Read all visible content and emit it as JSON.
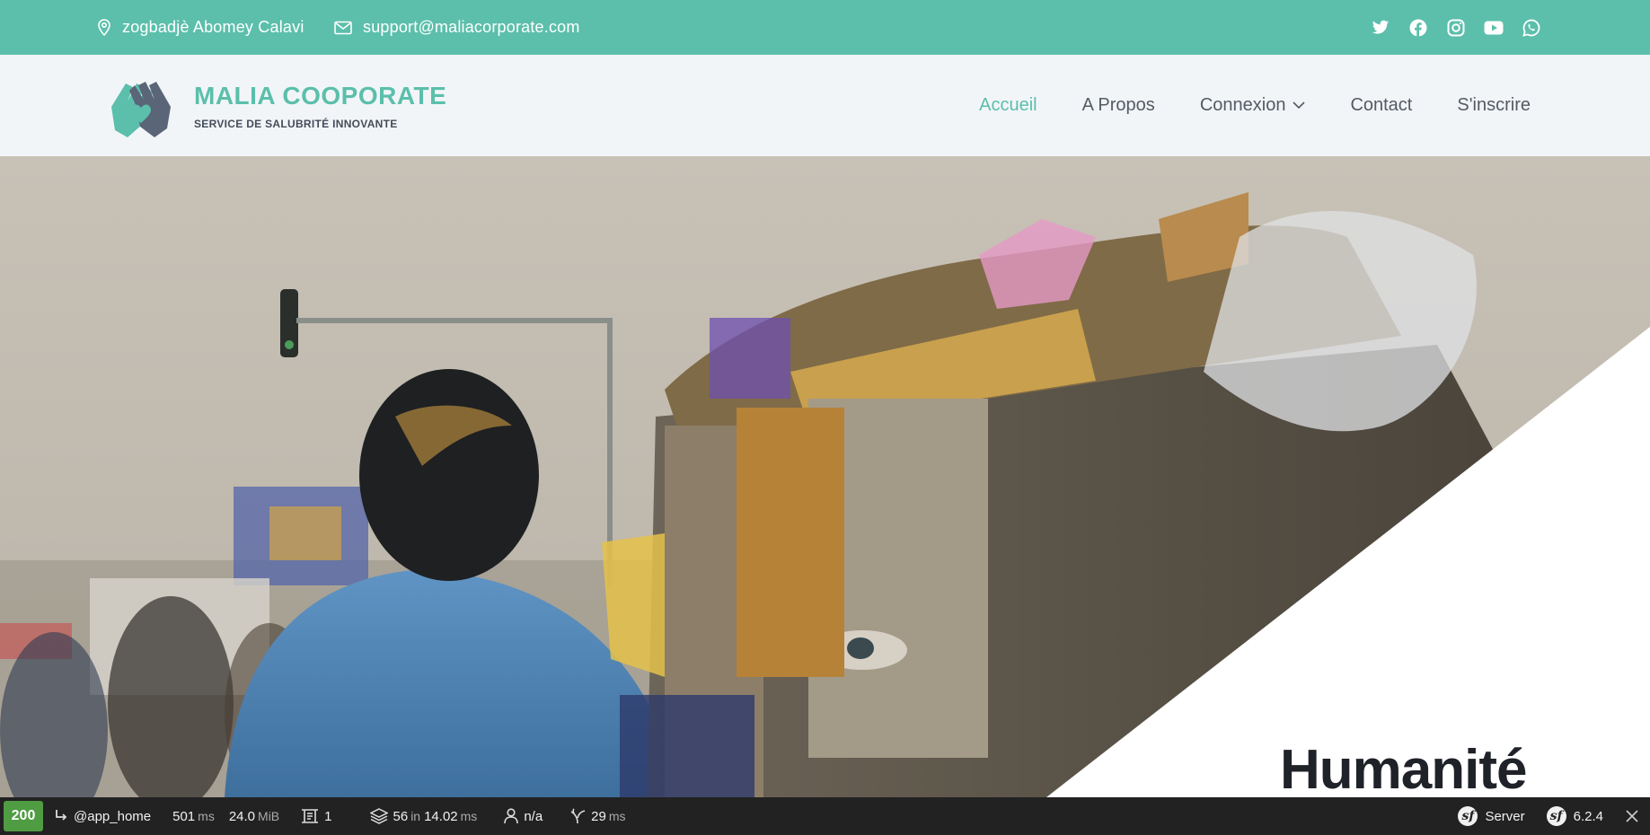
{
  "topbar": {
    "address": "zogbadjè Abomey Calavi",
    "email": "support@maliacorporate.com",
    "socials": [
      "twitter-icon",
      "facebook-icon",
      "instagram-icon",
      "youtube-icon",
      "whatsapp-icon"
    ],
    "bg_color": "#5bbfab"
  },
  "brand": {
    "title": "MALIA COOPORATE",
    "subtitle": "SERVICE DE SALUBRITÉ INNOVANTE",
    "accent": "#5bbfab"
  },
  "nav": {
    "items": [
      {
        "label": "Accueil",
        "active": true
      },
      {
        "label": "A Propos"
      },
      {
        "label": "Connexion",
        "dropdown": true
      },
      {
        "label": "Contact"
      },
      {
        "label": "S'inscrire"
      }
    ]
  },
  "hero": {
    "title": "Humanité"
  },
  "debug_toolbar": {
    "status": "200",
    "route": "@app_home",
    "time_value": "501",
    "time_unit": "ms",
    "memory_value": "24.0",
    "memory_unit": "MiB",
    "logs_count": "1",
    "cache_count": "56",
    "cache_in": "in",
    "cache_time": "14.02",
    "cache_unit": "ms",
    "user": "n/a",
    "twig_time": "29",
    "twig_unit": "ms",
    "server_label": "Server",
    "version": "6.2.4",
    "status_color": "#4f9c42"
  }
}
